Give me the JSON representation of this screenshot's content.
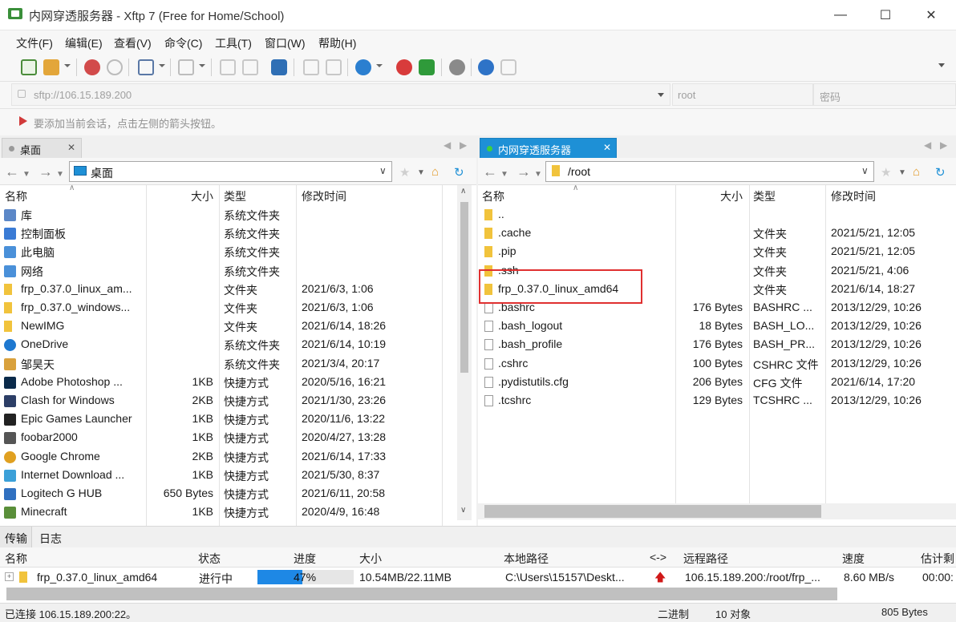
{
  "window": {
    "title": "内网穿透服务器 - Xftp 7 (Free for Home/School)"
  },
  "menu": [
    "文件(F)",
    "编辑(E)",
    "查看(V)",
    "命令(C)",
    "工具(T)",
    "窗口(W)",
    "帮助(H)"
  ],
  "address": {
    "url": "sftp://106.15.189.200",
    "user": "root",
    "password_placeholder": "密码"
  },
  "hint": "要添加当前会话，点击左侧的箭头按钮。",
  "left": {
    "tab": "桌面",
    "path": "桌面",
    "headers": {
      "name": "名称",
      "size": "大小",
      "type": "类型",
      "mtime": "修改时间"
    },
    "rows": [
      {
        "name": "库",
        "size": "",
        "type": "系统文件夹",
        "mtime": "",
        "icon": "library-icon"
      },
      {
        "name": "控制面板",
        "size": "",
        "type": "系统文件夹",
        "mtime": "",
        "icon": "control-panel-icon"
      },
      {
        "name": "此电脑",
        "size": "",
        "type": "系统文件夹",
        "mtime": "",
        "icon": "computer-icon"
      },
      {
        "name": "网络",
        "size": "",
        "type": "系统文件夹",
        "mtime": "",
        "icon": "network-icon"
      },
      {
        "name": "frp_0.37.0_linux_am...",
        "size": "",
        "type": "文件夹",
        "mtime": "2021/6/3, 1:06",
        "icon": "folder-icon"
      },
      {
        "name": "frp_0.37.0_windows...",
        "size": "",
        "type": "文件夹",
        "mtime": "2021/6/3, 1:06",
        "icon": "folder-icon"
      },
      {
        "name": "NewIMG",
        "size": "",
        "type": "文件夹",
        "mtime": "2021/6/14, 18:26",
        "icon": "folder-icon"
      },
      {
        "name": "OneDrive",
        "size": "",
        "type": "系统文件夹",
        "mtime": "2021/6/14, 10:19",
        "icon": "onedrive-icon"
      },
      {
        "name": "邹昊天",
        "size": "",
        "type": "系统文件夹",
        "mtime": "2021/3/4, 20:17",
        "icon": "user-folder-icon"
      },
      {
        "name": "Adobe Photoshop ...",
        "size": "1KB",
        "type": "快捷方式",
        "mtime": "2020/5/16, 16:21",
        "icon": "photoshop-icon"
      },
      {
        "name": "Clash for Windows",
        "size": "2KB",
        "type": "快捷方式",
        "mtime": "2021/1/30, 23:26",
        "icon": "clash-icon"
      },
      {
        "name": "Epic Games Launcher",
        "size": "1KB",
        "type": "快捷方式",
        "mtime": "2020/11/6, 13:22",
        "icon": "epic-icon"
      },
      {
        "name": "foobar2000",
        "size": "1KB",
        "type": "快捷方式",
        "mtime": "2020/4/27, 13:28",
        "icon": "foobar-icon"
      },
      {
        "name": "Google Chrome",
        "size": "2KB",
        "type": "快捷方式",
        "mtime": "2021/6/14, 17:33",
        "icon": "chrome-icon"
      },
      {
        "name": "Internet Download ...",
        "size": "1KB",
        "type": "快捷方式",
        "mtime": "2021/5/30, 8:37",
        "icon": "idm-icon"
      },
      {
        "name": "Logitech G HUB",
        "size": "650 Bytes",
        "type": "快捷方式",
        "mtime": "2021/6/11, 20:58",
        "icon": "ghub-icon"
      },
      {
        "name": "Minecraft",
        "size": "1KB",
        "type": "快捷方式",
        "mtime": "2020/4/9, 16:48",
        "icon": "minecraft-icon"
      }
    ]
  },
  "right": {
    "tab": "内网穿透服务器",
    "path": "/root",
    "headers": {
      "name": "名称",
      "size": "大小",
      "type": "类型",
      "mtime": "修改时间"
    },
    "rows": [
      {
        "name": "..",
        "size": "",
        "type": "",
        "mtime": "",
        "icon": "folder-icon"
      },
      {
        "name": ".cache",
        "size": "",
        "type": "文件夹",
        "mtime": "2021/5/21, 12:05",
        "icon": "folder-icon"
      },
      {
        "name": ".pip",
        "size": "",
        "type": "文件夹",
        "mtime": "2021/5/21, 12:05",
        "icon": "folder-icon"
      },
      {
        "name": ".ssh",
        "size": "",
        "type": "文件夹",
        "mtime": "2021/5/21, 4:06",
        "icon": "folder-icon"
      },
      {
        "name": "frp_0.37.0_linux_amd64",
        "size": "",
        "type": "文件夹",
        "mtime": "2021/6/14, 18:27",
        "icon": "folder-icon"
      },
      {
        "name": ".bashrc",
        "size": "176 Bytes",
        "type": "BASHRC ...",
        "mtime": "2013/12/29, 10:26",
        "icon": "file-icon"
      },
      {
        "name": ".bash_logout",
        "size": "18 Bytes",
        "type": "BASH_LO...",
        "mtime": "2013/12/29, 10:26",
        "icon": "file-icon"
      },
      {
        "name": ".bash_profile",
        "size": "176 Bytes",
        "type": "BASH_PR...",
        "mtime": "2013/12/29, 10:26",
        "icon": "file-icon"
      },
      {
        "name": ".cshrc",
        "size": "100 Bytes",
        "type": "CSHRC 文件",
        "mtime": "2013/12/29, 10:26",
        "icon": "file-icon"
      },
      {
        "name": ".pydistutils.cfg",
        "size": "206 Bytes",
        "type": "CFG 文件",
        "mtime": "2021/6/14, 17:20",
        "icon": "file-icon"
      },
      {
        "name": ".tcshrc",
        "size": "129 Bytes",
        "type": "TCSHRC ...",
        "mtime": "2013/12/29, 10:26",
        "icon": "file-icon"
      }
    ]
  },
  "transfer": {
    "tabs": [
      "传输",
      "日志"
    ],
    "headers": [
      "名称",
      "状态",
      "进度",
      "大小",
      "本地路径",
      "<->",
      "远程路径",
      "速度",
      "估计剩"
    ],
    "row": {
      "name": "frp_0.37.0_linux_amd64",
      "status": "进行中",
      "progress": 0.47,
      "progress_label": "47%",
      "size": "10.54MB/22.11MB",
      "local": "C:\\Users\\15157\\Deskt...",
      "remote": "106.15.189.200:/root/frp_...",
      "speed": "8.60 MB/s",
      "eta": "00:00:"
    }
  },
  "status": {
    "connection": "已连接 106.15.189.200:22。",
    "mode": "二进制",
    "objects": "10 对象",
    "bytes": "805 Bytes"
  },
  "colors": {
    "accent": "#1e90d6",
    "progress": "#1e88e5",
    "highlight": "#e03030"
  }
}
